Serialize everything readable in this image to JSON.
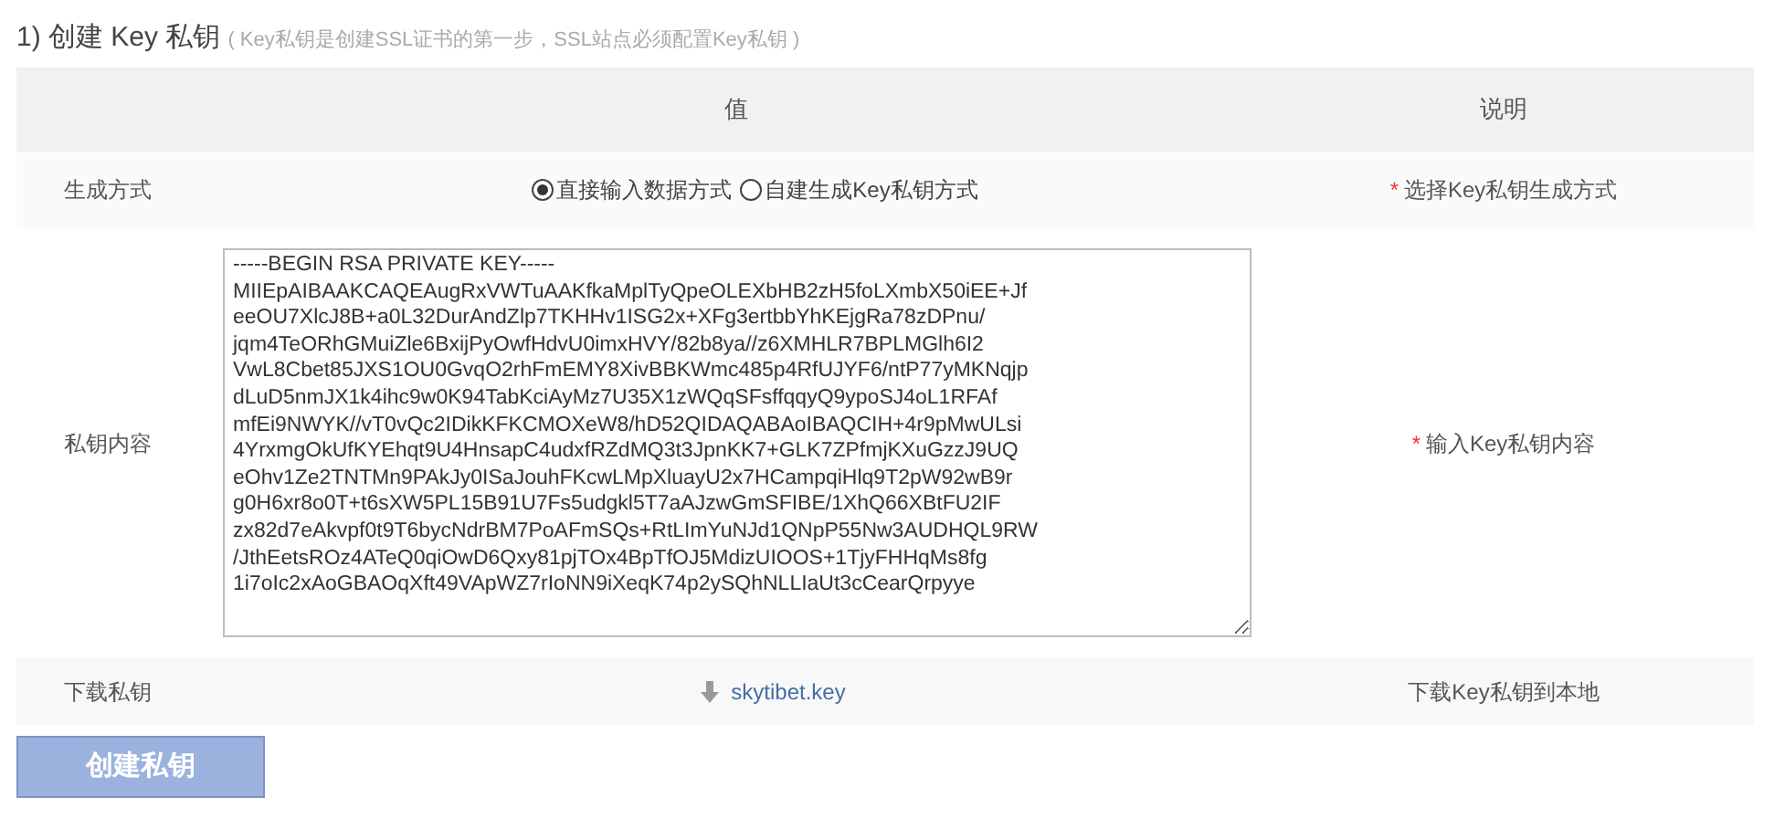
{
  "heading": {
    "title": "1) 创建 Key 私钥",
    "note": "( Key私钥是创建SSL证书的第一步，SSL站点必须配置Key私钥 )"
  },
  "table": {
    "columns": [
      "值",
      "说明"
    ],
    "rows": [
      {
        "kind": "radio",
        "label": "生成方式",
        "options": [
          {
            "label": "直接输入数据方式",
            "selected": true
          },
          {
            "label": "自建生成Key私钥方式",
            "selected": false
          }
        ],
        "mark": "*",
        "description": "选择Key私钥生成方式"
      },
      {
        "kind": "textarea",
        "label": "私钥内容",
        "value": [
          "-----BEGIN RSA PRIVATE KEY-----",
          "MIIEpAIBAAKCAQEAugRxVWTuAAKfkaMplTyQpeOLEXbHB2zH5foLXmbX50iEE+Jf",
          "eeOU7XlcJ8B+a0L32DurAndZlp7TKHHv1ISG2x+XFg3ertbbYhKEjgRa78zDPnu/",
          "jqm4TeORhGMuiZle6BxijPyOwfHdvU0imxHVY/82b8ya//z6XMHLR7BPLMGlh6I2",
          "VwL8Cbet85JXS1OU0GvqO2rhFmEMY8XivBBKWmc485p4RfUJYF6/ntP77yMKNqjp",
          "dLuD5nmJX1k4ihc9w0K94TabKciAyMz7U35X1zWQqSFsffqqyQ9ypoSJ4oL1RFAf",
          "mfEi9NWYK//vT0vQc2IDikKFKCMOXeW8/hD52QIDAQABAoIBAQCIH+4r9pMwULsi",
          "4YrxmgOkUfKYEhqt9U4HnsapC4udxfRZdMQ3t3JpnKK7+GLK7ZPfmjKXuGzzJ9UQ",
          "eOhv1Ze2TNTMn9PAkJy0ISaJouhFKcwLMpXluayU2x7HCampqiHlq9T2pW92wB9r",
          "g0H6xr8o0T+t6sXW5PL15B91U7Fs5udgkl5T7aAJzwGmSFIBE/1XhQ66XBtFU2IF",
          "zx82d7eAkvpf0t9T6bycNdrBM7PoAFmSQs+RtLImYuNJd1QNpP55Nw3AUDHQL9RW",
          "/JthEetsROz4ATeQ0qiOwD6Qxy81pjTOx4BpTfOJ5MdizUIOOS+1TjyFHHqMs8fg",
          "1i7oIc2xAoGBAOqXft49VApWZ7rIoNN9iXeqK74p2ySQhNLLIaUt3cCearQrpyye"
        ],
        "mark": "*",
        "description": "输入Key私钥内容"
      },
      {
        "kind": "download",
        "label": "下载私钥",
        "file": "skytibet.key",
        "description": "下载Key私钥到本地"
      }
    ]
  },
  "button": "创建私钥"
}
